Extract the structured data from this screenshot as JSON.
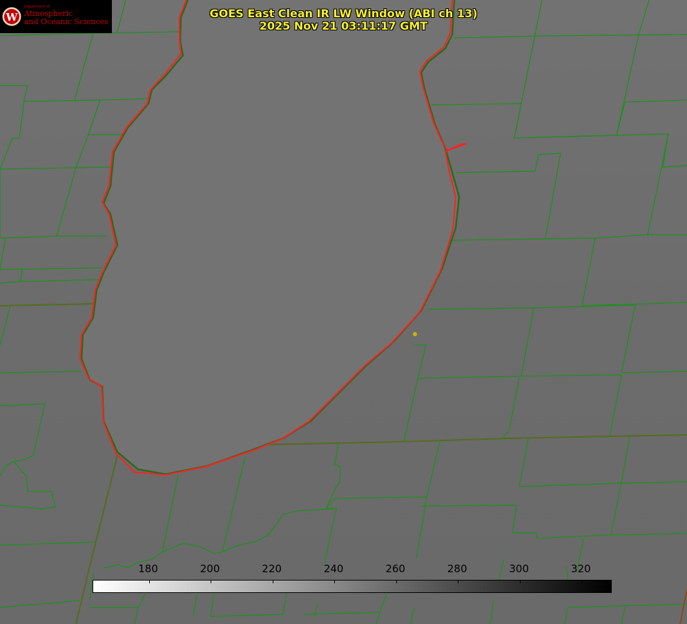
{
  "header": {
    "title_line1": "GOES East Clean IR LW Window (ABI ch 13)",
    "title_line2": "2025 Nov 21 03:11:17 GMT"
  },
  "logo": {
    "small_text": "Department of",
    "line1": "Atmospheric",
    "line2": "and Oceanic Sciences",
    "seal_letter": "W",
    "color": "#c5050c"
  },
  "map": {
    "background_color": "#6e6e6e",
    "lake_color": "#737373",
    "county_line_color": "#1f8f1f",
    "state_line_color": "#8a4a1a",
    "coastline_color": "#ff2020",
    "marker_color": "#c8b414"
  },
  "colorbar": {
    "range": [
      162,
      330
    ],
    "gradient": [
      "#ffffff",
      "#000000"
    ],
    "ticks": [
      {
        "value": 180,
        "label": "180"
      },
      {
        "value": 200,
        "label": "200"
      },
      {
        "value": 220,
        "label": "220"
      },
      {
        "value": 240,
        "label": "240"
      },
      {
        "value": 260,
        "label": "260"
      },
      {
        "value": 280,
        "label": "280"
      },
      {
        "value": 300,
        "label": "300"
      },
      {
        "value": 320,
        "label": "320"
      }
    ]
  }
}
